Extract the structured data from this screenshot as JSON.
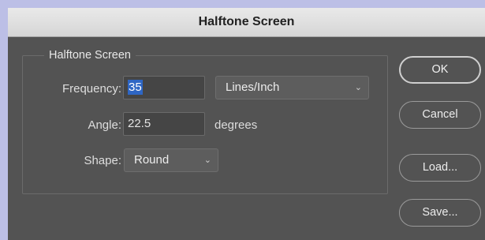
{
  "window": {
    "title": "Halftone Screen"
  },
  "group": {
    "title": "Halftone Screen"
  },
  "frequency": {
    "label": "Frequency:",
    "value": "35",
    "unit": "Lines/Inch"
  },
  "angle": {
    "label": "Angle:",
    "value": "22.5",
    "unit": "degrees"
  },
  "shape": {
    "label": "Shape:",
    "value": "Round"
  },
  "buttons": {
    "ok": "OK",
    "cancel": "Cancel",
    "load": "Load...",
    "save": "Save..."
  }
}
